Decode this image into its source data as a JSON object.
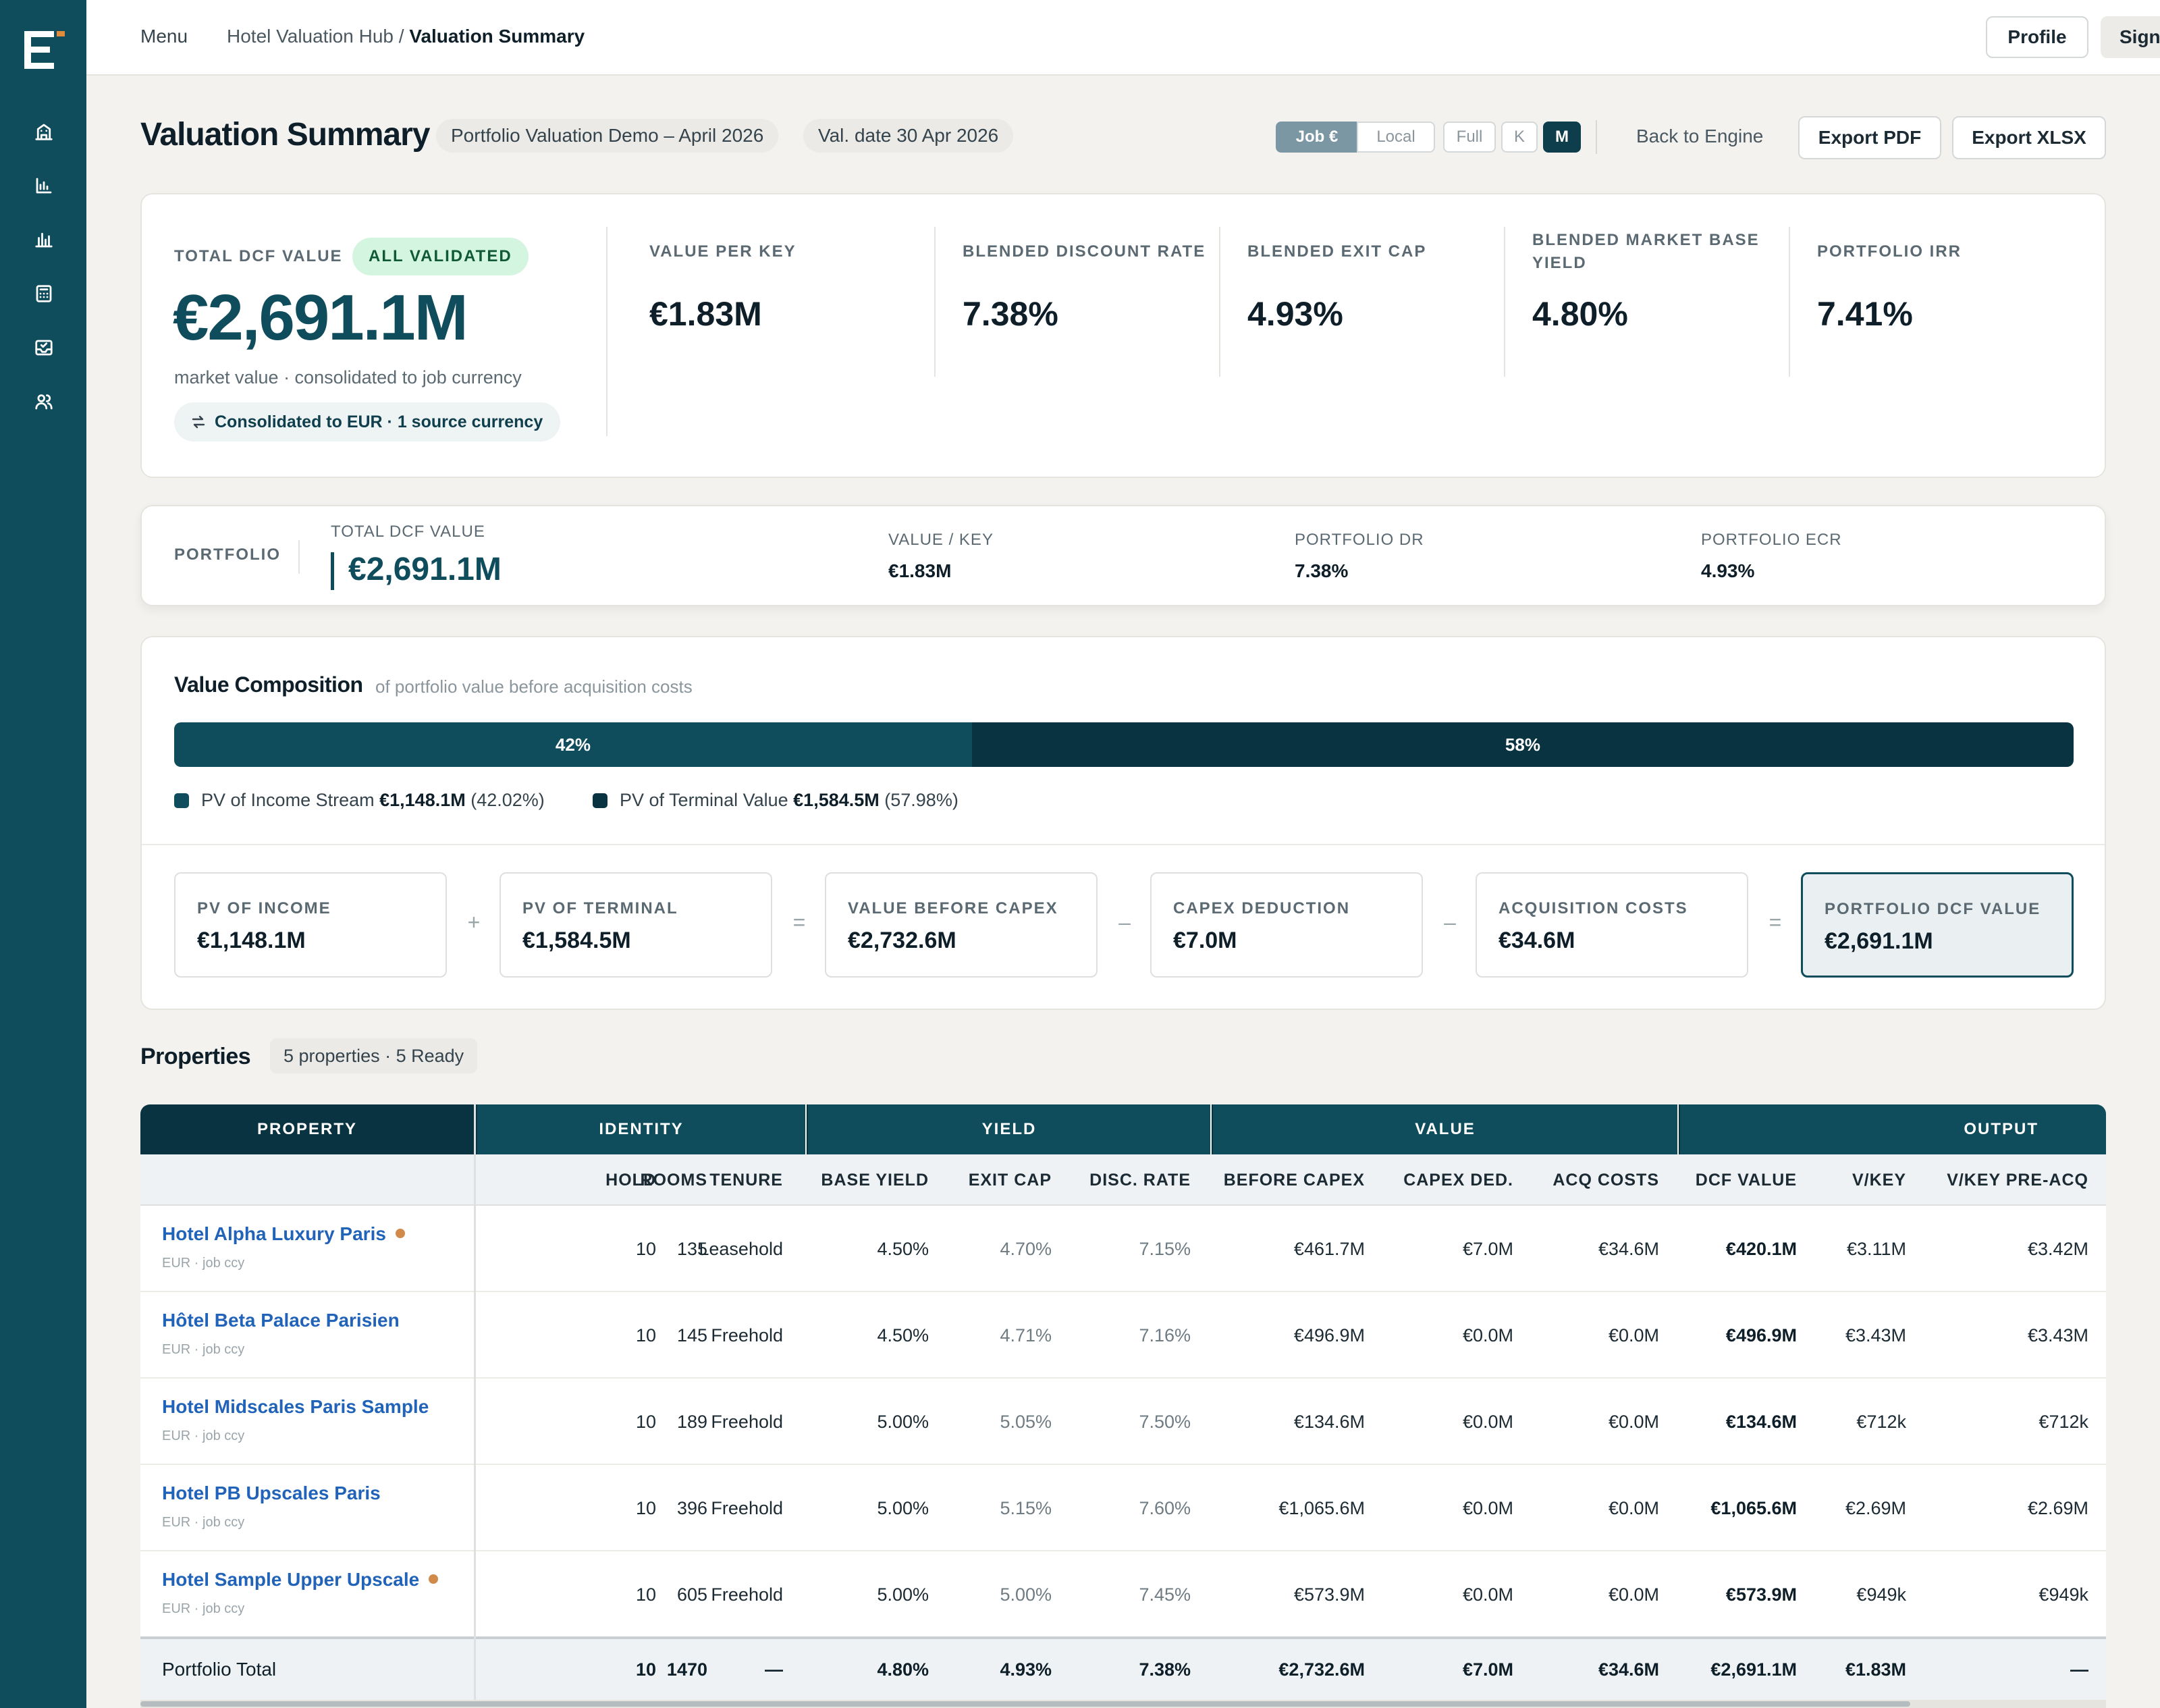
{
  "topbar": {
    "menu": "Menu",
    "breadcrumb_parent": "Hotel Valuation Hub /",
    "breadcrumb_current": "Valuation Summary",
    "profile": "Profile",
    "sign_out": "Sign out"
  },
  "sidebar": {
    "icons": [
      "hotel-icon",
      "bar-chart-icon",
      "chart-columns-icon",
      "calculator-icon",
      "inbox-check-icon",
      "users-icon"
    ]
  },
  "header": {
    "title": "Valuation Summary",
    "portfolio_chip": "Portfolio Valuation Demo – April 2026",
    "date_chip": "Val. date 30 Apr 2026",
    "currency_toggle": [
      "Job €",
      "Local"
    ],
    "currency_selected": "Job €",
    "unit_toggle": [
      "Full",
      "K",
      "M"
    ],
    "unit_selected": "M",
    "back_link": "Back to Engine",
    "export_pdf": "Export PDF",
    "export_xlsx": "Export XLSX"
  },
  "kpi": {
    "main_label": "TOTAL DCF VALUE",
    "status_badge": "ALL VALIDATED",
    "main_value": "€2,691.1M",
    "main_sub": "market value · consolidated to job currency",
    "consolidation": "Consolidated to EUR · 1 source currency",
    "metrics": [
      {
        "label": "VALUE PER KEY",
        "value": "€1.83M"
      },
      {
        "label": "BLENDED DISCOUNT RATE",
        "value": "7.38%"
      },
      {
        "label": "BLENDED EXIT CAP",
        "value": "4.93%"
      },
      {
        "label": "BLENDED MARKET BASE YIELD",
        "value": "4.80%"
      },
      {
        "label": "PORTFOLIO IRR",
        "value": "7.41%"
      }
    ]
  },
  "portfolio_strip": {
    "label": "PORTFOLIO",
    "total_label": "TOTAL DCF VALUE",
    "total_value": "€2,691.1M",
    "metrics": [
      {
        "label": "VALUE / KEY",
        "value": "€1.83M"
      },
      {
        "label": "PORTFOLIO DR",
        "value": "7.38%"
      },
      {
        "label": "PORTFOLIO ECR",
        "value": "4.93%"
      }
    ]
  },
  "composition": {
    "title": "Value Composition",
    "subtitle": "of portfolio value before acquisition costs",
    "income_share": 0.42,
    "terminal_share": 0.58,
    "income_pct_label": "42%",
    "terminal_pct_label": "58%",
    "legend": [
      {
        "label": "PV of Income Stream",
        "value": "€1,148.1M",
        "pct": "(42.02%)",
        "color": "#0f4c5c"
      },
      {
        "label": "PV of Terminal Value",
        "value": "€1,584.5M",
        "pct": "(57.98%)",
        "color": "#0a3342"
      }
    ],
    "tiles": [
      {
        "label": "PV OF INCOME",
        "value": "€1,148.1M"
      },
      {
        "label": "PV OF TERMINAL",
        "value": "€1,584.5M"
      },
      {
        "label": "VALUE BEFORE CAPEX",
        "value": "€2,732.6M"
      },
      {
        "label": "CAPEX DEDUCTION",
        "value": "€7.0M"
      },
      {
        "label": "ACQUISITION COSTS",
        "value": "€34.6M"
      },
      {
        "label": "PORTFOLIO DCF VALUE",
        "value": "€2,691.1M"
      }
    ],
    "operators": [
      "+",
      "=",
      "–",
      "–",
      "="
    ]
  },
  "properties": {
    "title": "Properties",
    "summary": "5 properties · 5 Ready",
    "groups": [
      "PROPERTY",
      "IDENTITY",
      "YIELD",
      "VALUE",
      "OUTPUT"
    ],
    "columns": [
      "ROOMS",
      "HOLD",
      "TENURE",
      "BASE YIELD",
      "EXIT CAP",
      "DISC. RATE",
      "BEFORE CAPEX",
      "CAPEX DED.",
      "ACQ COSTS",
      "DCF VALUE",
      "V/KEY",
      "V/KEY PRE-ACQ"
    ],
    "rows": [
      {
        "name": "Hotel Alpha Luxury Paris",
        "flag": true,
        "ccy": "EUR · job ccy",
        "cells": [
          "135",
          "10",
          "Leasehold",
          "4.50%",
          "4.70%",
          "7.15%",
          "€461.7M",
          "€7.0M",
          "€34.6M",
          "€420.1M",
          "€3.11M",
          "€3.42M"
        ]
      },
      {
        "name": "Hôtel Beta Palace Parisien",
        "flag": false,
        "ccy": "EUR · job ccy",
        "cells": [
          "145",
          "10",
          "Freehold",
          "4.50%",
          "4.71%",
          "7.16%",
          "€496.9M",
          "€0.0M",
          "€0.0M",
          "€496.9M",
          "€3.43M",
          "€3.43M"
        ]
      },
      {
        "name": "Hotel Midscales Paris Sample",
        "flag": false,
        "ccy": "EUR · job ccy",
        "cells": [
          "189",
          "10",
          "Freehold",
          "5.00%",
          "5.05%",
          "7.50%",
          "€134.6M",
          "€0.0M",
          "€0.0M",
          "€134.6M",
          "€712k",
          "€712k"
        ]
      },
      {
        "name": "Hotel PB Upscales Paris",
        "flag": false,
        "ccy": "EUR · job ccy",
        "cells": [
          "396",
          "10",
          "Freehold",
          "5.00%",
          "5.15%",
          "7.60%",
          "€1,065.6M",
          "€0.0M",
          "€0.0M",
          "€1,065.6M",
          "€2.69M",
          "€2.69M"
        ]
      },
      {
        "name": "Hotel Sample Upper Upscale",
        "flag": true,
        "ccy": "EUR · job ccy",
        "cells": [
          "605",
          "10",
          "Freehold",
          "5.00%",
          "5.00%",
          "7.45%",
          "€573.9M",
          "€0.0M",
          "€0.0M",
          "€573.9M",
          "€949k",
          "€949k"
        ]
      }
    ],
    "total": {
      "label": "Portfolio Total",
      "cells": [
        "1470",
        "10",
        "—",
        "4.80%",
        "4.93%",
        "7.38%",
        "€2,732.6M",
        "€7.0M",
        "€34.6M",
        "€2,691.1M",
        "€1.83M",
        "—"
      ]
    }
  }
}
